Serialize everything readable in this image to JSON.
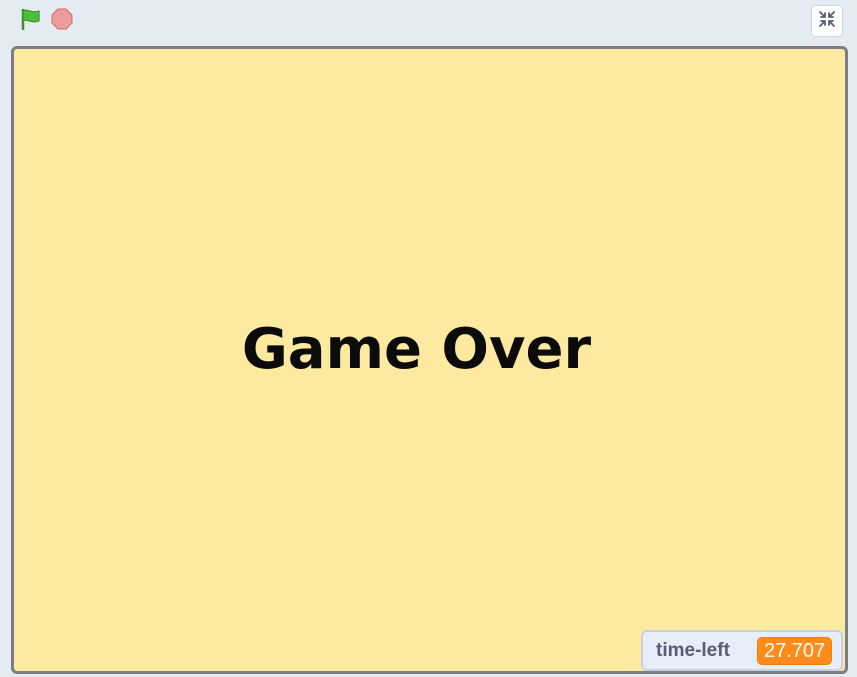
{
  "toolbar": {
    "green_flag_icon": "green-flag-icon",
    "stop_icon": "stop-sign-icon",
    "fullscreen_icon": "exit-fullscreen-icon"
  },
  "stage": {
    "message": "Game Over",
    "background_color": "#fde9a0"
  },
  "monitor": {
    "label": "time-left",
    "value": "27.707",
    "value_color": "#ff8c1a"
  }
}
